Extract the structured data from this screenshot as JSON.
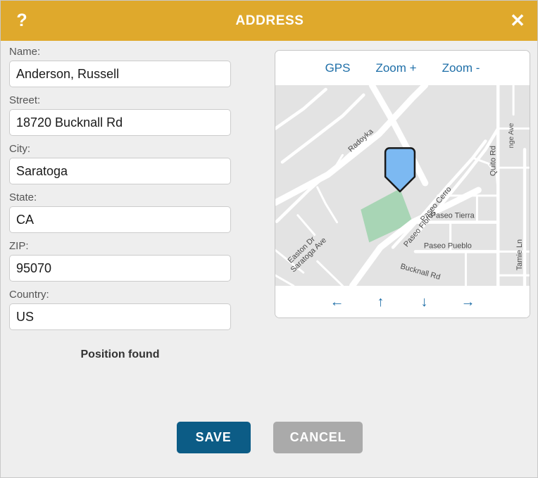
{
  "window": {
    "title": "ADDRESS",
    "help_icon": "question-mark-icon",
    "close_icon": "close-icon",
    "header_color": "#dfa92c",
    "background_color": "#eeeeee"
  },
  "form": {
    "fields": [
      {
        "label": "Name:",
        "value": "Anderson, Russell",
        "placeholder": ""
      },
      {
        "label": "Street:",
        "value": "18720 Bucknall Rd",
        "placeholder": ""
      },
      {
        "label": "City:",
        "value": "Saratoga",
        "placeholder": ""
      },
      {
        "label": "State:",
        "value": "CA",
        "placeholder": ""
      },
      {
        "label": "ZIP:",
        "value": "95070",
        "placeholder": ""
      },
      {
        "label": "Country:",
        "value": "US",
        "placeholder": ""
      }
    ],
    "status": "Position found"
  },
  "map": {
    "toolbar": [
      {
        "label": "GPS"
      },
      {
        "label": "Zoom +"
      },
      {
        "label": "Zoom -"
      }
    ],
    "nav": [
      {
        "label": "←",
        "icon": "arrow-left-icon"
      },
      {
        "label": "↑",
        "icon": "arrow-up-icon"
      },
      {
        "label": "↓",
        "icon": "arrow-down-icon"
      },
      {
        "label": "→",
        "icon": "arrow-right-icon"
      }
    ],
    "marker_color": "#7cb9f2",
    "link_color": "#1f6fa8",
    "land_color": "#e3e3e3",
    "road_color": "#ffffff",
    "park_color": "#a8d5b5",
    "street_labels": [
      "Easton Dr",
      "Radoyka Dr",
      "Saratoga Ave",
      "Paseo Cerro",
      "Paseo Flores",
      "Bucknall Rd",
      "Quito Rd",
      "Paseo Tierra",
      "Paseo Pueblo",
      "Tamie Ln"
    ]
  },
  "footer": {
    "save_label": "SAVE",
    "cancel_label": "CANCEL",
    "save_color": "#0c5c86",
    "cancel_color": "#aaaaaa"
  }
}
